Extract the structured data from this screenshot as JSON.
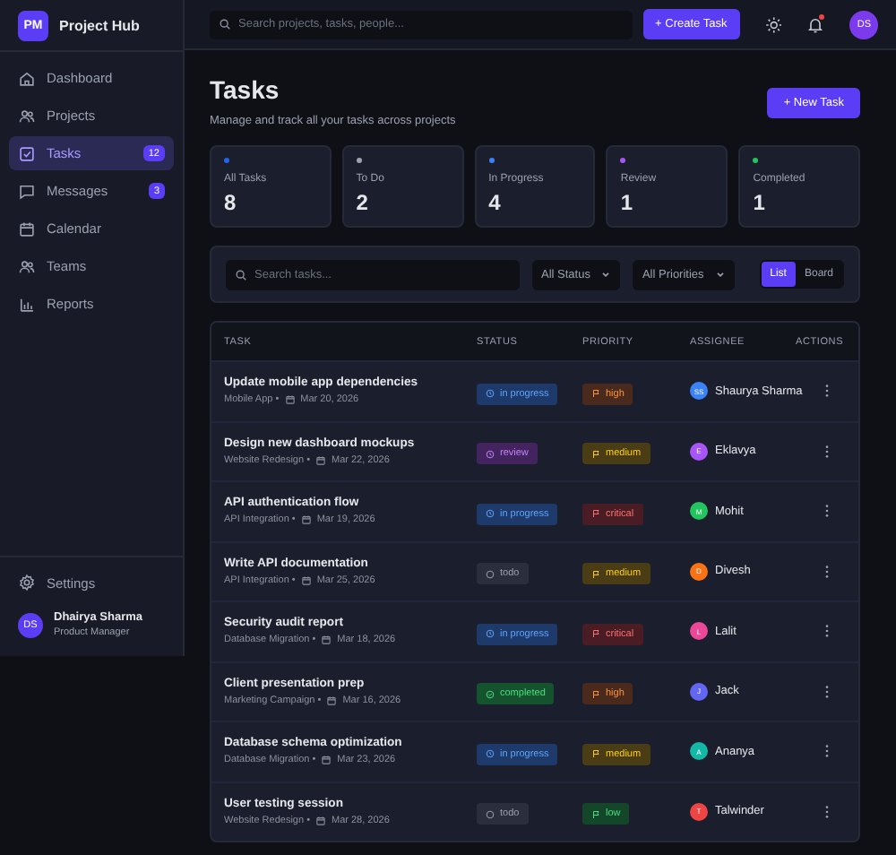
{
  "brand": {
    "initials": "PM",
    "name": "Project Hub"
  },
  "sidebar": {
    "items": [
      {
        "label": "Dashboard",
        "selected": false
      },
      {
        "label": "Projects",
        "selected": false
      },
      {
        "label": "Tasks",
        "selected": true,
        "badge": "12"
      },
      {
        "label": "Messages",
        "selected": false,
        "badge": "3"
      },
      {
        "label": "Calendar",
        "selected": false
      },
      {
        "label": "Teams",
        "selected": false
      },
      {
        "label": "Reports",
        "selected": false
      }
    ],
    "settings": "Settings",
    "user": {
      "initials": "DS",
      "name": "Dhairya Sharma",
      "role": "Product Manager"
    }
  },
  "topbar": {
    "search_placeholder": "Search projects, tasks, people...",
    "create_button": "+ Create Task",
    "notifications_unread": true,
    "avatar": "DS"
  },
  "page": {
    "title": "Tasks",
    "subtitle": "Manage and track all your tasks across projects",
    "new_button": "+ New Task"
  },
  "stats": [
    {
      "label": "All Tasks",
      "value": "8",
      "color": "#2563eb"
    },
    {
      "label": "To Do",
      "value": "2",
      "color": "#9ca3af"
    },
    {
      "label": "In Progress",
      "value": "4",
      "color": "#3b82f6"
    },
    {
      "label": "Review",
      "value": "1",
      "color": "#a855f7"
    },
    {
      "label": "Completed",
      "value": "1",
      "color": "#22c55e"
    }
  ],
  "filters": {
    "search_placeholder": "Search tasks...",
    "status": "All Status",
    "priority": "All Priorities",
    "views": [
      {
        "label": "List",
        "selected": true
      },
      {
        "label": "Board",
        "selected": false
      }
    ]
  },
  "table": {
    "columns": [
      "TASK",
      "STATUS",
      "PRIORITY",
      "ASSIGNEE",
      "ACTIONS"
    ],
    "rows": [
      {
        "title": "Update mobile app dependencies",
        "project": "Mobile App •",
        "date": "Mar 20, 2026",
        "status": {
          "kind": "in_progress",
          "label": "in progress"
        },
        "priority": {
          "kind": "high",
          "label": "high"
        },
        "assignee": {
          "initials": "SS",
          "name": "Shaurya Sharma",
          "color": "#3b82f6"
        }
      },
      {
        "title": "Design new dashboard mockups",
        "project": "Website Redesign •",
        "date": "Mar 22, 2026",
        "status": {
          "kind": "review",
          "label": "review"
        },
        "priority": {
          "kind": "medium",
          "label": "medium"
        },
        "assignee": {
          "initials": "E",
          "name": "Eklavya",
          "color": "#a855f7"
        }
      },
      {
        "title": "API authentication flow",
        "project": "API Integration •",
        "date": "Mar 19, 2026",
        "status": {
          "kind": "in_progress",
          "label": "in progress"
        },
        "priority": {
          "kind": "critical",
          "label": "critical"
        },
        "assignee": {
          "initials": "M",
          "name": "Mohit",
          "color": "#22c55e"
        }
      },
      {
        "title": "Write API documentation",
        "project": "API Integration •",
        "date": "Mar 25, 2026",
        "status": {
          "kind": "todo",
          "label": "todo"
        },
        "priority": {
          "kind": "medium",
          "label": "medium"
        },
        "assignee": {
          "initials": "D",
          "name": "Divesh",
          "color": "#f97316"
        }
      },
      {
        "title": "Security audit report",
        "project": "Database Migration •",
        "date": "Mar 18, 2026",
        "status": {
          "kind": "in_progress",
          "label": "in progress"
        },
        "priority": {
          "kind": "critical",
          "label": "critical"
        },
        "assignee": {
          "initials": "L",
          "name": "Lalit",
          "color": "#ec4899"
        }
      },
      {
        "title": "Client presentation prep",
        "project": "Marketing Campaign •",
        "date": "Mar 16, 2026",
        "status": {
          "kind": "completed",
          "label": "completed"
        },
        "priority": {
          "kind": "high",
          "label": "high"
        },
        "assignee": {
          "initials": "J",
          "name": "Jack",
          "color": "#6366f1"
        }
      },
      {
        "title": "Database schema optimization",
        "project": "Database Migration •",
        "date": "Mar 23, 2026",
        "status": {
          "kind": "in_progress",
          "label": "in progress"
        },
        "priority": {
          "kind": "medium",
          "label": "medium"
        },
        "assignee": {
          "initials": "A",
          "name": "Ananya",
          "color": "#14b8a6"
        }
      },
      {
        "title": "User testing session",
        "project": "Website Redesign •",
        "date": "Mar 28, 2026",
        "status": {
          "kind": "todo",
          "label": "todo"
        },
        "priority": {
          "kind": "low",
          "label": "low"
        },
        "assignee": {
          "initials": "T",
          "name": "Talwinder",
          "color": "#ef4444"
        }
      }
    ]
  }
}
